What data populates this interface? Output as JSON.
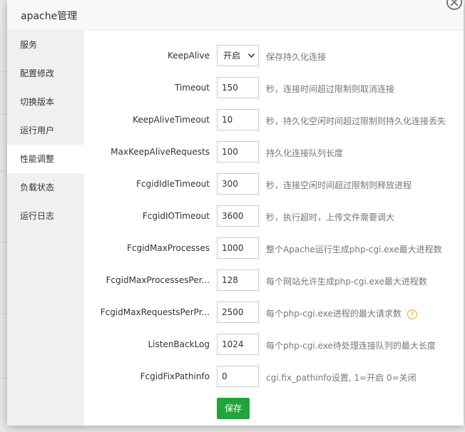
{
  "dialog": {
    "title": "apache管理"
  },
  "sidebar": {
    "items": [
      {
        "label": "服务",
        "active": false
      },
      {
        "label": "配置修改",
        "active": false
      },
      {
        "label": "切换版本",
        "active": false
      },
      {
        "label": "运行用户",
        "active": false
      },
      {
        "label": "性能调整",
        "active": true
      },
      {
        "label": "负载状态",
        "active": false
      },
      {
        "label": "运行日志",
        "active": false
      }
    ]
  },
  "form": {
    "rows": [
      {
        "label": "KeepAlive",
        "value": "开启",
        "type": "select",
        "hint": "保存持久化连接"
      },
      {
        "label": "Timeout",
        "value": "150",
        "type": "input",
        "hint": "秒，连接时间超过限制则取消连接"
      },
      {
        "label": "KeepAliveTimeout",
        "value": "10",
        "type": "input",
        "hint": "秒，持久化空闲时间超过限制则持久化连接丢失"
      },
      {
        "label": "MaxKeepAliveRequests",
        "value": "100",
        "type": "input",
        "hint": "持久化连接队列长度"
      },
      {
        "label": "FcgidIdleTimeout",
        "value": "300",
        "type": "input",
        "hint": "秒，连接空闲时间超过限制则释放进程"
      },
      {
        "label": "FcgidIOTimeout",
        "value": "3600",
        "type": "input",
        "hint": "秒，执行超时，上传文件需要调大"
      },
      {
        "label": "FcgidMaxProcesses",
        "value": "1000",
        "type": "input",
        "hint": "整个Apache运行生成php-cgi.exe最大进程数"
      },
      {
        "label": "FcgidMaxProcessesPer...",
        "value": "128",
        "type": "input",
        "hint": "每个网站允许生成php-cgi.exe最大进程数"
      },
      {
        "label": "FcgidMaxRequestsPerPr...",
        "value": "2500",
        "type": "input",
        "hint": "每个php-cgi.exe进程的最大请求数",
        "help": "?"
      },
      {
        "label": "ListenBackLog",
        "value": "1024",
        "type": "input",
        "hint": "每个php-cgi.exe待处理连接队列的最大长度"
      },
      {
        "label": "FcgidFixPathinfo",
        "value": "0",
        "type": "input",
        "hint": "cgi.fix_pathinfo设置, 1=开启 0=关闭"
      }
    ],
    "save_label": "保存"
  },
  "colors": {
    "accent": "#20a53a",
    "sidebar_bg": "#f0f0f0",
    "help": "#f0a82b"
  }
}
